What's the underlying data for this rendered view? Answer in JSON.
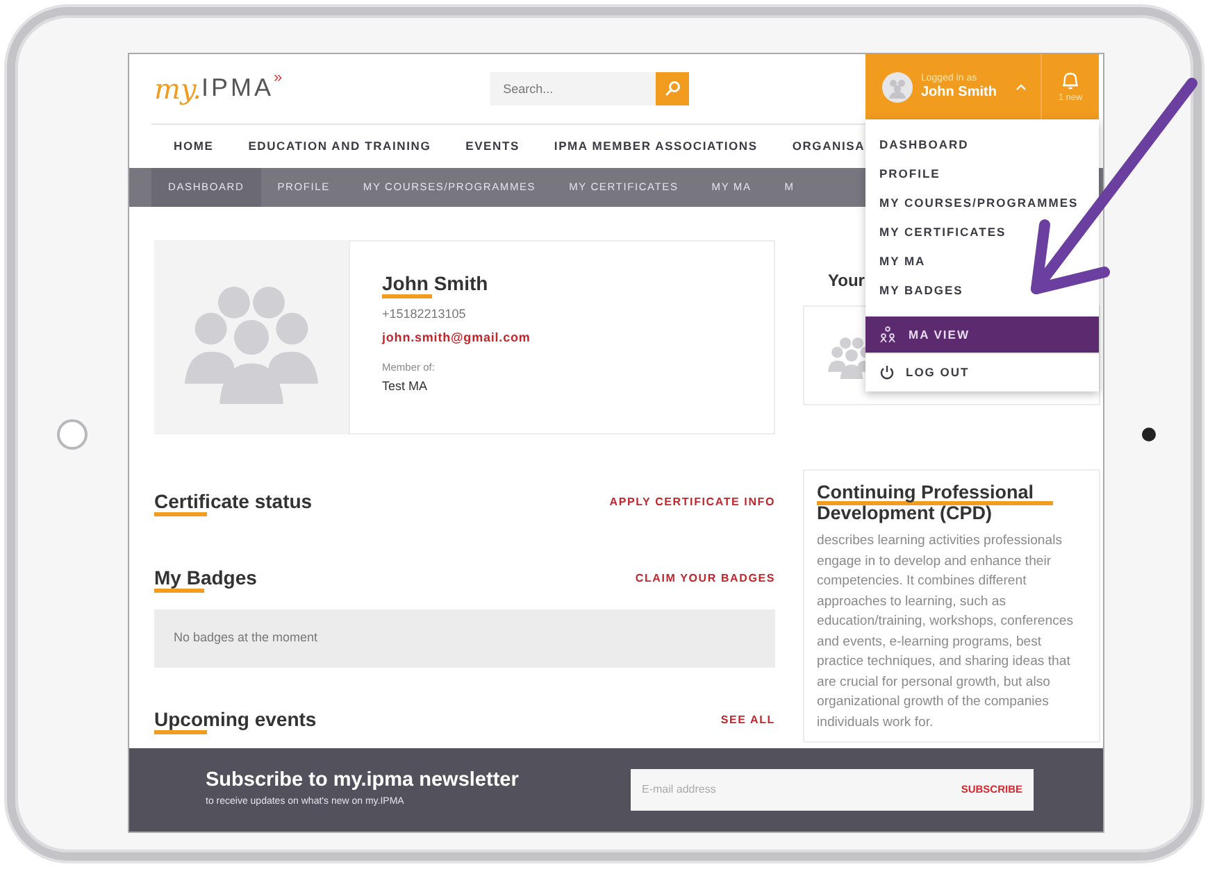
{
  "header": {
    "logo_script": "my.",
    "logo_text": "IPMA",
    "logo_mark": "»",
    "search": {
      "placeholder": "Search..."
    },
    "user": {
      "caption": "Logged in as",
      "name": "John Smith",
      "expanded": true
    },
    "notifications": {
      "count_label": "1 new"
    }
  },
  "main_nav": [
    {
      "label": "HOME"
    },
    {
      "label": "EDUCATION AND TRAINING"
    },
    {
      "label": "EVENTS"
    },
    {
      "label": "IPMA MEMBER ASSOCIATIONS"
    },
    {
      "label": "ORGANISA"
    }
  ],
  "sub_nav": [
    {
      "label": "DASHBOARD",
      "selected": true
    },
    {
      "label": "PROFILE",
      "selected": false
    },
    {
      "label": "MY COURSES/PROGRAMMES",
      "selected": false
    },
    {
      "label": "MY CERTIFICATES",
      "selected": false
    },
    {
      "label": "MY MA",
      "selected": false
    },
    {
      "label": "M",
      "selected": false
    }
  ],
  "profile": {
    "name": "John Smith",
    "phone": "+15182213105",
    "email": "john.smith@gmail.com",
    "member_label": "Member of:",
    "member_value": "Test MA"
  },
  "side_heading": "Your",
  "sections": [
    {
      "title": "Certificate status",
      "action": "APPLY CERTIFICATE INFO"
    },
    {
      "title": "My Badges",
      "action": "CLAIM YOUR BADGES",
      "empty_text": "No badges at the moment"
    },
    {
      "title": "Upcoming events",
      "action": "SEE ALL"
    }
  ],
  "cpd": {
    "title": "Continuing Professional Development (CPD)",
    "text": "describes learning activities professionals engage in to develop and enhance their competencies. It combines different approaches to learning, such as education/training, workshops, conferences and events, e-learning programs, best practice techniques, and sharing ideas that are crucial for personal growth, but also organizational growth of the companies individuals work for."
  },
  "newsletter": {
    "title": "Subscribe to my.ipma newsletter",
    "subtitle": "to receive updates on what's new on my.IPMA",
    "email_placeholder": "E-mail address",
    "button": "SUBSCRIBE"
  },
  "user_menu": [
    {
      "label": "DASHBOARD",
      "kind": "link"
    },
    {
      "label": "PROFILE",
      "kind": "link"
    },
    {
      "label": "MY COURSES/PROGRAMMES",
      "kind": "link"
    },
    {
      "label": "MY CERTIFICATES",
      "kind": "link"
    },
    {
      "label": "MY MA",
      "kind": "link"
    },
    {
      "label": "MY BADGES",
      "kind": "link"
    },
    {
      "label": "MA VIEW",
      "kind": "highlight"
    },
    {
      "label": "LOG OUT",
      "kind": "logout"
    }
  ]
}
